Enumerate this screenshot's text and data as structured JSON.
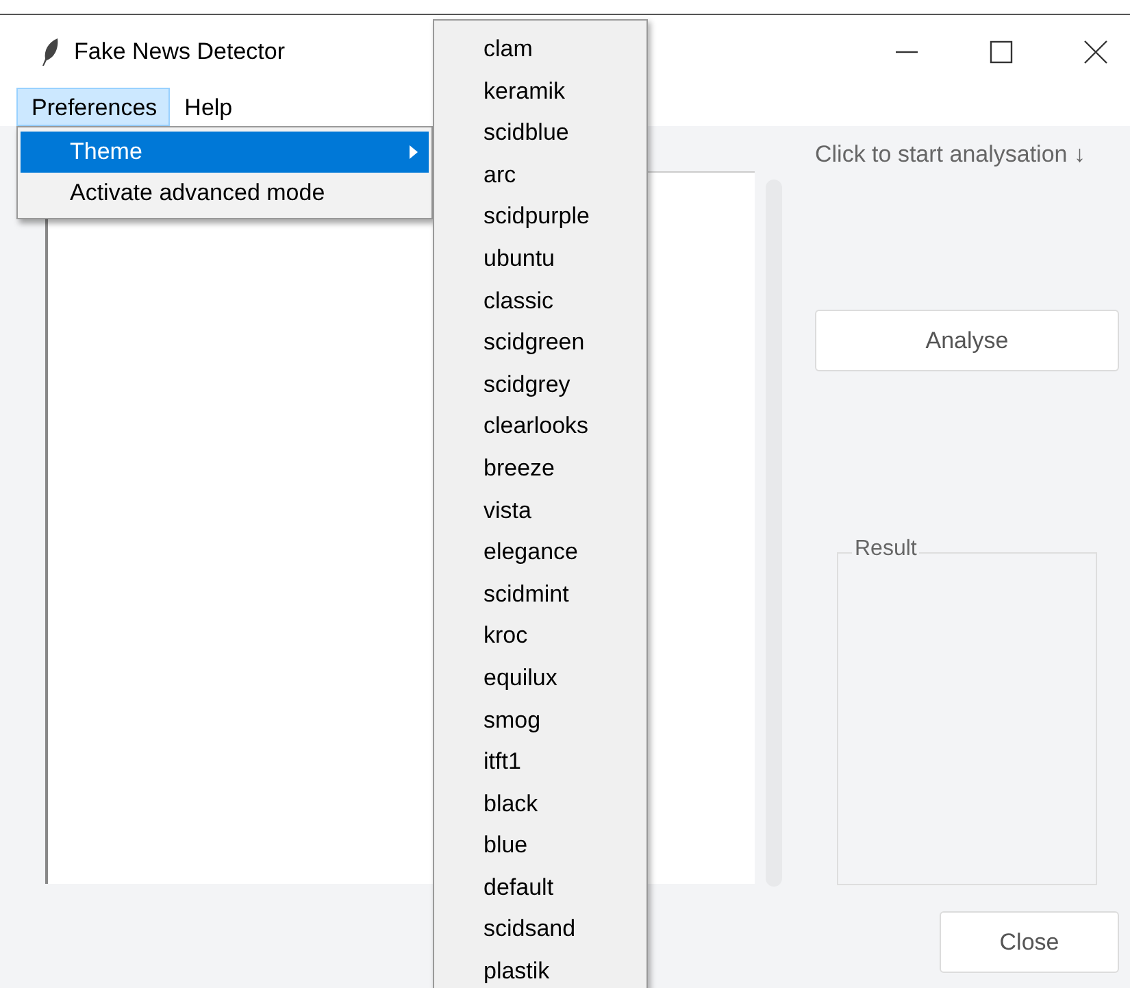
{
  "window": {
    "title": "Fake News Detector"
  },
  "menubar": [
    {
      "label": "Preferences",
      "selected": true
    },
    {
      "label": "Help",
      "selected": false
    }
  ],
  "menu": {
    "items": [
      {
        "label": "Theme",
        "selected": true,
        "kind": "submenu"
      },
      {
        "label": "Activate advanced mode",
        "selected": false,
        "kind": "command"
      }
    ]
  },
  "theme_submenu": {
    "items": [
      "clam",
      "keramik",
      "scidblue",
      "arc",
      "scidpurple",
      "ubuntu",
      "classic",
      "scidgreen",
      "scidgrey",
      "clearlooks",
      "breeze",
      "vista",
      "elegance",
      "scidmint",
      "kroc",
      "equilux",
      "smog",
      "itft1",
      "black",
      "blue",
      "default",
      "scidsand",
      "plastik"
    ]
  },
  "hint": "Click to start analysation ↓",
  "analyse_button": "Analyse",
  "result_group": {
    "label": "Result"
  },
  "close_button": "Close"
}
